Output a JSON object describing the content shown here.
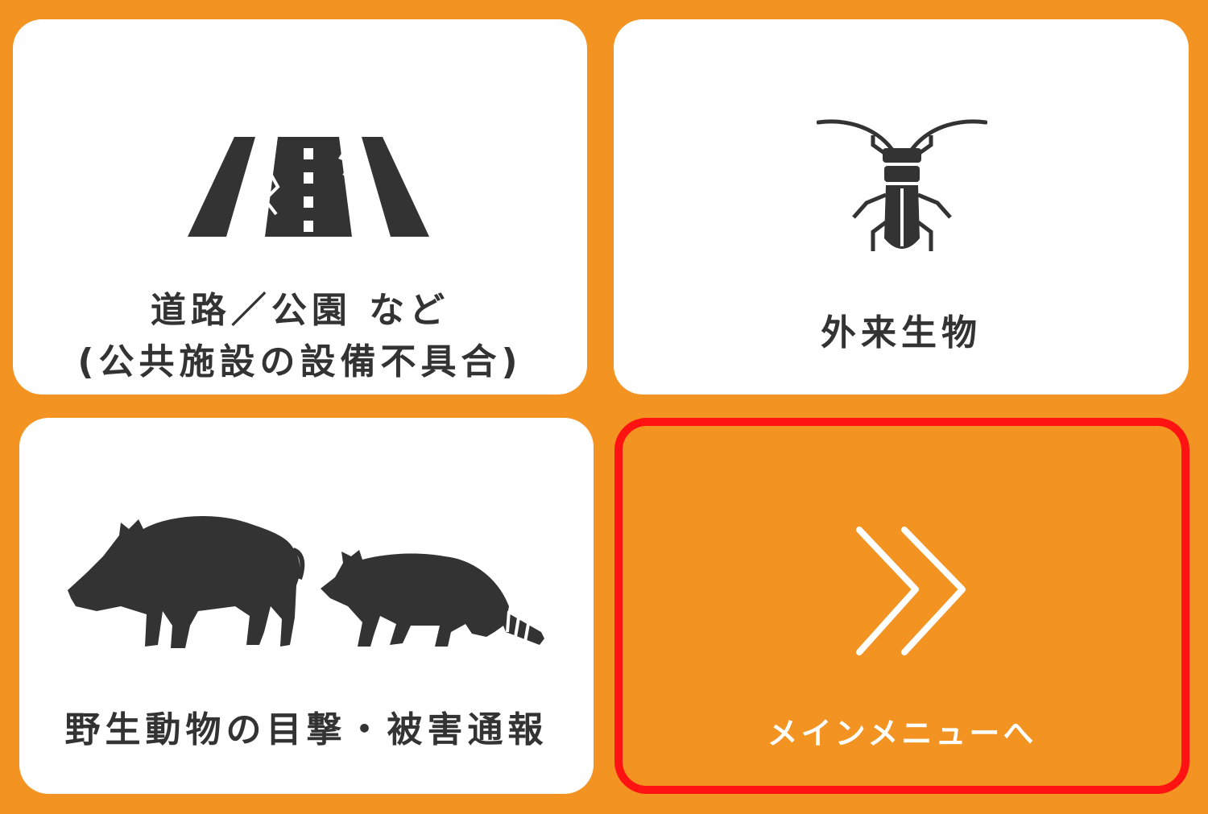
{
  "tiles": {
    "road": {
      "line1": "道路／公園 など",
      "line2": "(公共施設の設備不具合)",
      "icon": "cracked-road-icon"
    },
    "insect": {
      "label": "外来生物",
      "icon": "beetle-icon"
    },
    "wildlife": {
      "label": "野生動物の目撃・被害通報",
      "icon": "boar-and-raccoon-icon"
    },
    "menu": {
      "label": "メインメニューへ",
      "icon": "double-chevron-right-icon"
    }
  },
  "colors": {
    "background": "#F39322",
    "tile": "#FFFFFF",
    "icon": "#333333",
    "highlight_border": "#FF1212"
  }
}
